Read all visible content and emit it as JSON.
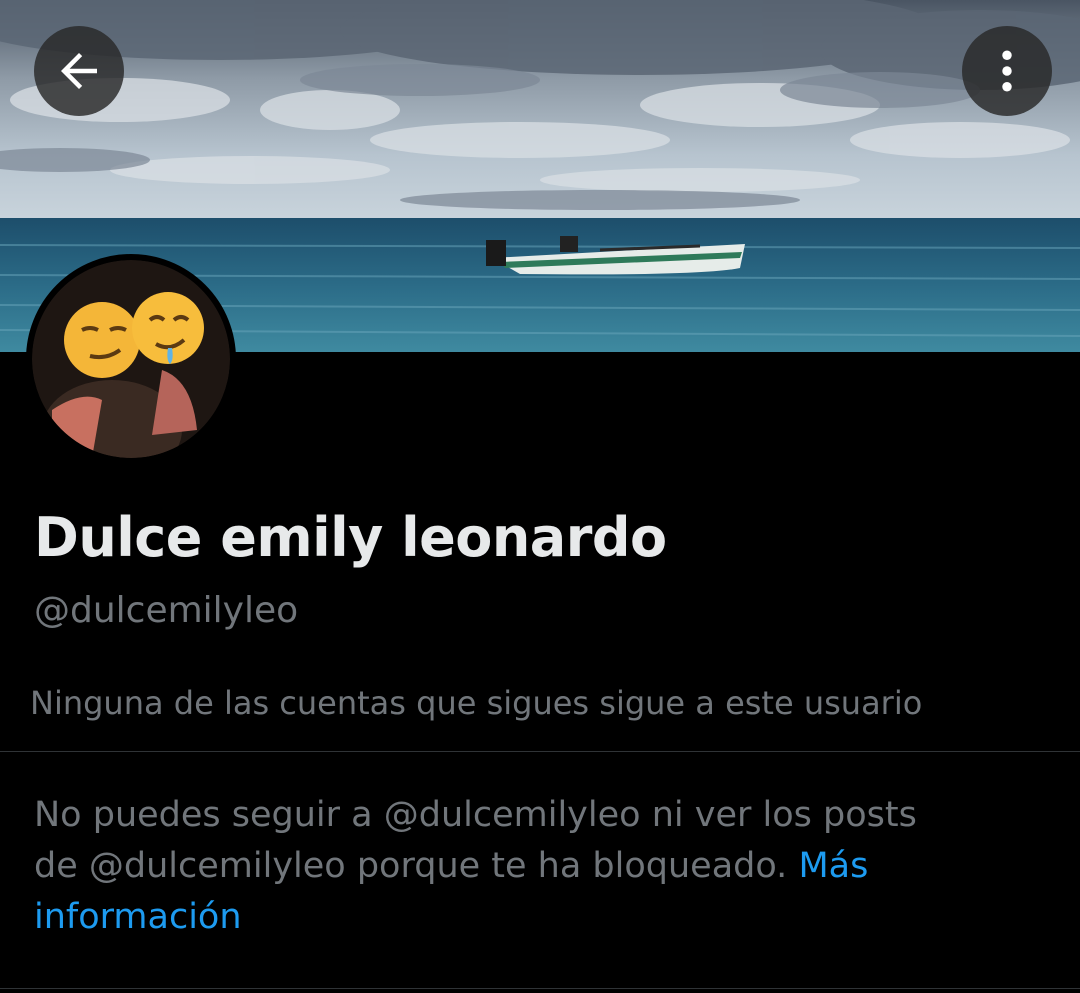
{
  "header": {
    "back_icon": "arrow-left-icon",
    "more_icon": "vertical-dots-icon"
  },
  "banner": {
    "description_icon": "banner-photo"
  },
  "profile": {
    "display_name": "Dulce emily leonardo",
    "handle": "@dulcemilyleo",
    "followers_you_know": "Ninguna de las cuentas que sigues sigue a este usuario"
  },
  "blocked": {
    "message": "No puedes seguir a @dulcemilyleo ni ver los posts de @dulcemilyleo porque te ha bloqueado.",
    "link_label": "Más información"
  },
  "colors": {
    "background": "#000000",
    "primary_text": "#e7e9ea",
    "secondary_text": "#71767b",
    "link": "#1d9bf0",
    "divider": "#2f3336"
  }
}
